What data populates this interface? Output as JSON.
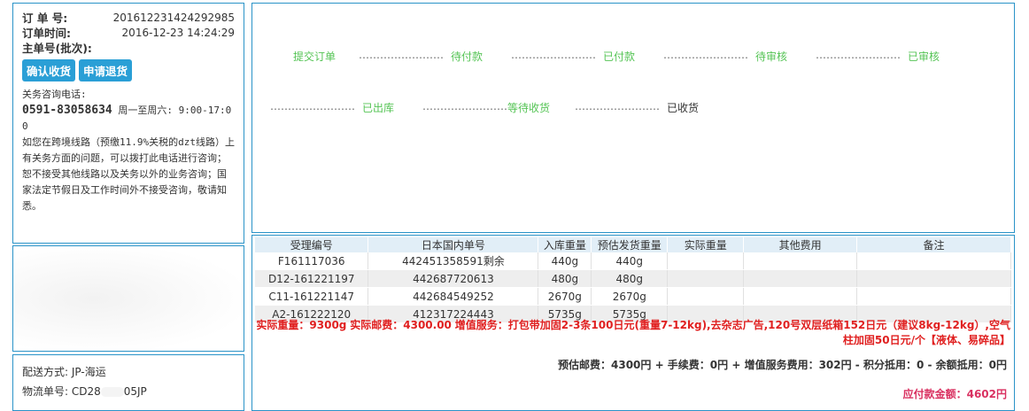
{
  "order": {
    "no_label": "订 单 号:",
    "no": "201612231424292985",
    "time_label": "订单时间:",
    "time": "2016-12-23 14:24:29",
    "batch_label": "主单号(批次):",
    "confirm_btn": "确认收货",
    "return_btn": "申请退货",
    "customs_label": "关务咨询电话:",
    "phone": "0591-83058634",
    "hours": "周一至周六: 9:00-17:00",
    "notice": "如您在跨境线路（预缴11.9%关税的dzt线路）上有关务方面的问题，可以拨打此电话进行咨询；恕不接受其他线路以及关务以外的业务咨询；国家法定节假日及工作时间外不接受咨询，敬请知悉。"
  },
  "shipping": {
    "method_label": "配送方式: ",
    "method": "JP-海运",
    "tracking_label": "物流单号: ",
    "tracking_prefix": "CD28",
    "tracking_suffix": "05JP"
  },
  "progress": {
    "steps": [
      "提交订单",
      "待付款",
      "已付款",
      "待审核",
      "已审核",
      "已出库",
      "等待收货",
      "已收货"
    ],
    "connector": "……………………"
  },
  "table": {
    "headers": [
      "受理编号",
      "日本国内单号",
      "入库重量",
      "预估发货重量",
      "实际重量",
      "其他费用",
      "备注"
    ],
    "rows": [
      [
        "F161117036",
        "442451358591剩余",
        "440g",
        "440g",
        "",
        "",
        ""
      ],
      [
        "D12-161221197",
        "442687720613",
        "480g",
        "480g",
        "",
        "",
        ""
      ],
      [
        "C11-161221147",
        "442684549252",
        "2670g",
        "2670g",
        "",
        "",
        ""
      ],
      [
        "A2-161222120",
        "412317224443",
        "5735g",
        "5735g",
        "",
        "",
        ""
      ]
    ]
  },
  "summary": {
    "actual_weight_label": "实际重量：",
    "actual_weight": "9300g",
    "actual_postage_label": "实际邮费：",
    "actual_postage": "4300.00",
    "service_label": "增值服务：",
    "service_text": "打包带加固2-3条100日元(重量7-12kg),去杂志广告,120号双层纸箱152日元（建议8kg-12kg）,空气柱加固50日元/个【液体、易碎品】",
    "fees_line": "预估邮费：4300円 + 手续费：0円 + 增值服务费用：302円 - 积分抵用：0 - 余额抵用：0円",
    "payable_line": "应付款金额：4602円"
  },
  "colors": {
    "border": "#2a93c8",
    "button": "#2a9fd6",
    "step_done": "#55c455",
    "highlight_red": "#e02020",
    "payable": "#d93060"
  }
}
